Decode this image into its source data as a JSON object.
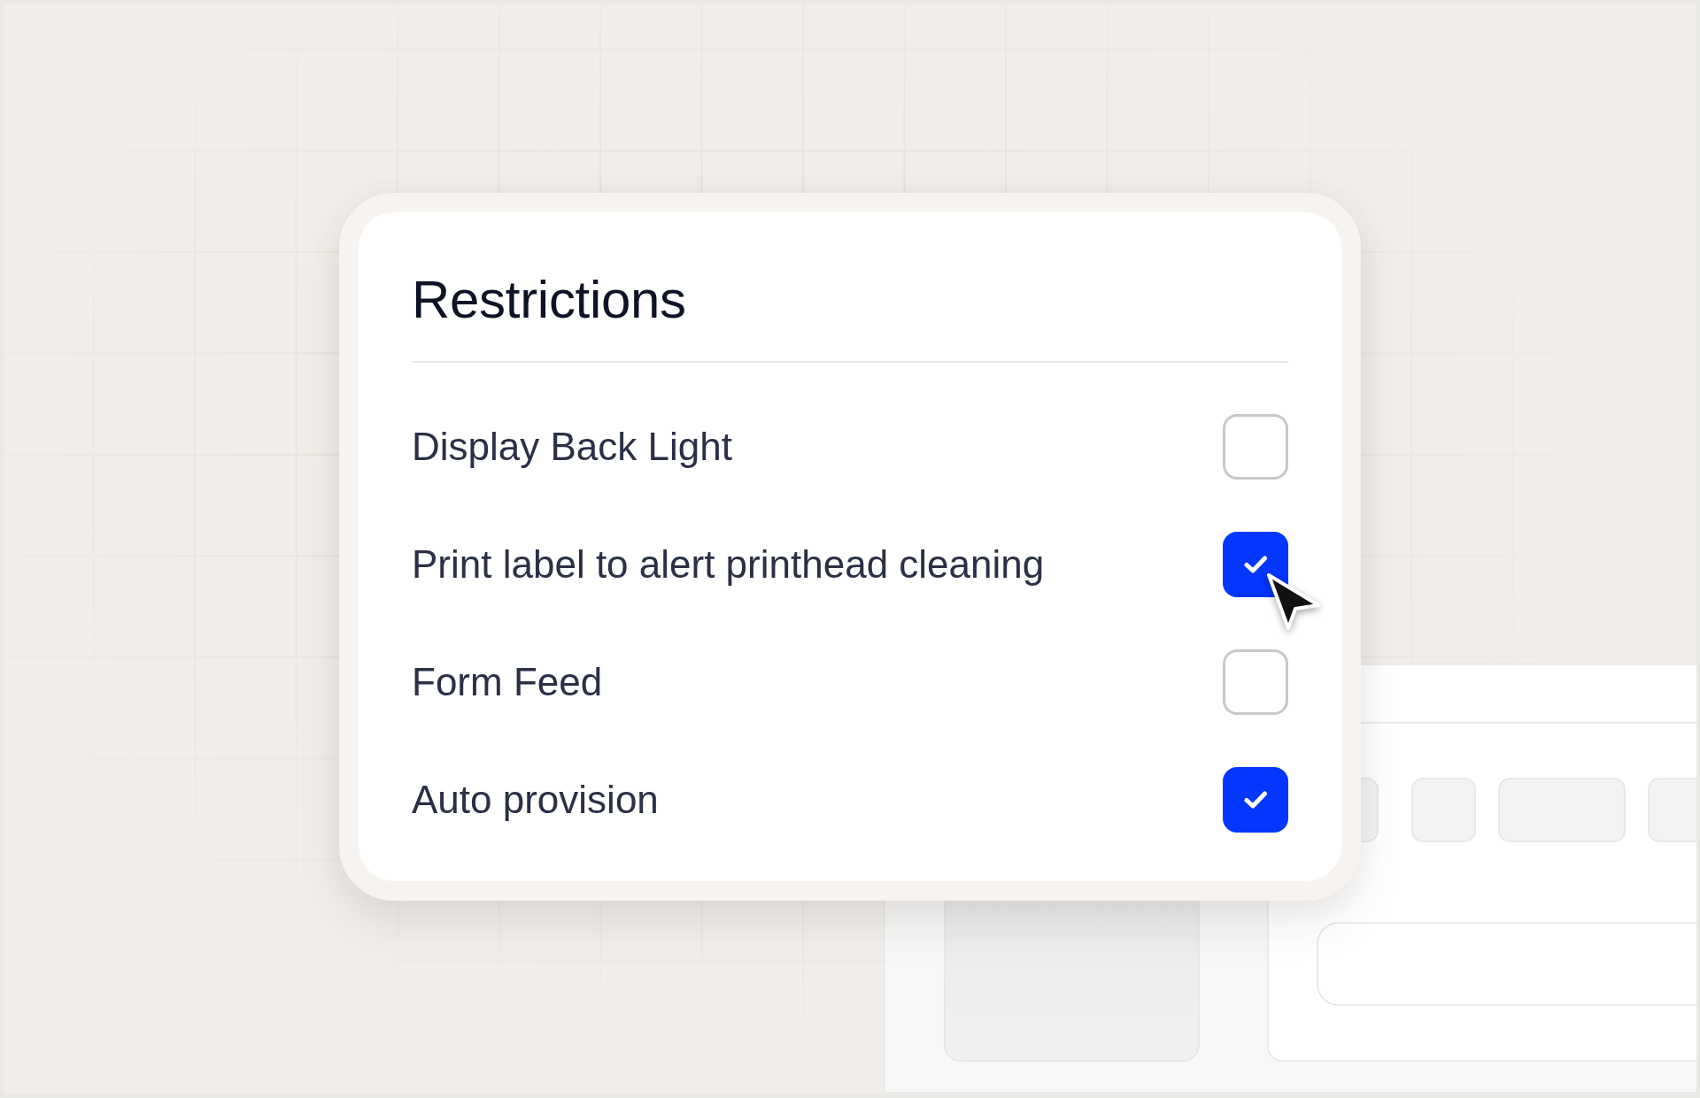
{
  "card": {
    "title": "Restrictions",
    "options": [
      {
        "label": "Display Back Light",
        "checked": false,
        "hovered": false
      },
      {
        "label": "Print label to alert printhead cleaning",
        "checked": true,
        "hovered": true
      },
      {
        "label": "Form Feed",
        "checked": false,
        "hovered": false
      },
      {
        "label": "Auto provision",
        "checked": true,
        "hovered": false
      }
    ]
  }
}
